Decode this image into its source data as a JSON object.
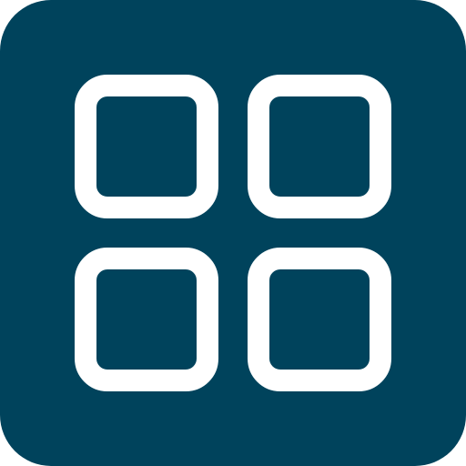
{
  "icon": {
    "name": "grid-menu-icon",
    "background_color": "#00435C",
    "stroke_color": "#FFFFFF"
  }
}
